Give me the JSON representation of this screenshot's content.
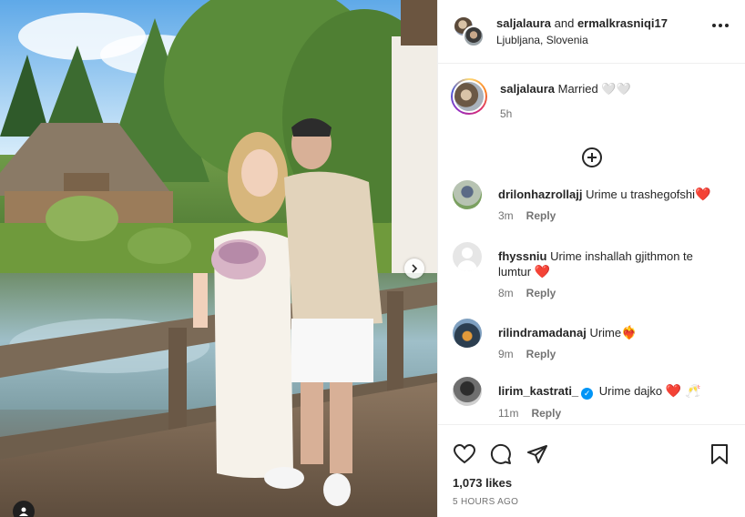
{
  "header": {
    "user1": "saljalaura",
    "conj": "and",
    "user2": "ermalkrasniqi17",
    "location": "Ljubljana, Slovenia"
  },
  "caption": {
    "username": "saljalaura",
    "text": "Married 🤍🤍",
    "time": "5h"
  },
  "comments": [
    {
      "username": "drilonhazrollajj",
      "text": "Urime u trashegofshi",
      "emoji": "❤️",
      "time": "3m",
      "reply": "Reply",
      "icon": "avatar-photo"
    },
    {
      "username": "fhyssniu",
      "text": "Urime inshallah gjithmon te lumtur",
      "emoji": "❤️",
      "time": "8m",
      "reply": "Reply",
      "icon": "default-avatar"
    },
    {
      "username": "rilindramadanaj",
      "text": "Urime",
      "emoji": "❤️‍🔥",
      "time": "9m",
      "reply": "Reply",
      "icon": "avatar-photo"
    },
    {
      "username": "lirim_kastrati_",
      "verified": true,
      "text": "Urime dajko",
      "emoji": "❤️ 🥂",
      "time": "11m",
      "reply": "Reply",
      "icon": "avatar-photo"
    }
  ],
  "actions": {
    "likes": "1,073 likes",
    "posted": "5 HOURS AGO"
  },
  "icons": {
    "like": "heart-icon",
    "comment": "comment-icon",
    "share": "share-icon",
    "save": "bookmark-icon",
    "more": "more-icon",
    "load_more": "plus-circle-icon",
    "next": "chevron-right-icon",
    "tags": "user-tag-icon"
  },
  "colors": {
    "heart": "#ed1c3b",
    "verified": "#0095f6",
    "muted": "#737373"
  }
}
